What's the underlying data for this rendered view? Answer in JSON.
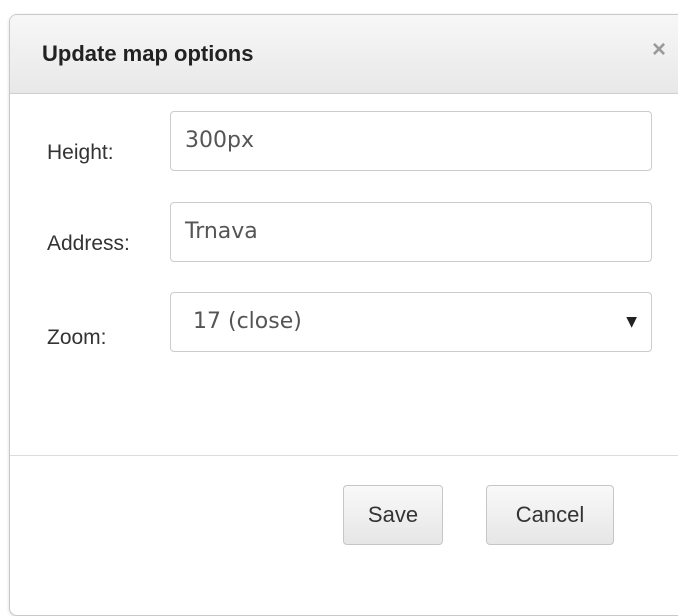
{
  "dialog": {
    "title": "Update map options",
    "close_glyph": "×"
  },
  "form": {
    "height_label": "Height:",
    "height_value": "300px",
    "address_label": "Address:",
    "address_value": "Trnava",
    "zoom_label": "Zoom:",
    "zoom_value": "17 (close)",
    "zoom_arrow": "▼"
  },
  "footer": {
    "save_label": "Save",
    "cancel_label": "Cancel"
  },
  "icons": {
    "close": "close-icon",
    "dropdown": "chevron-down-icon"
  }
}
